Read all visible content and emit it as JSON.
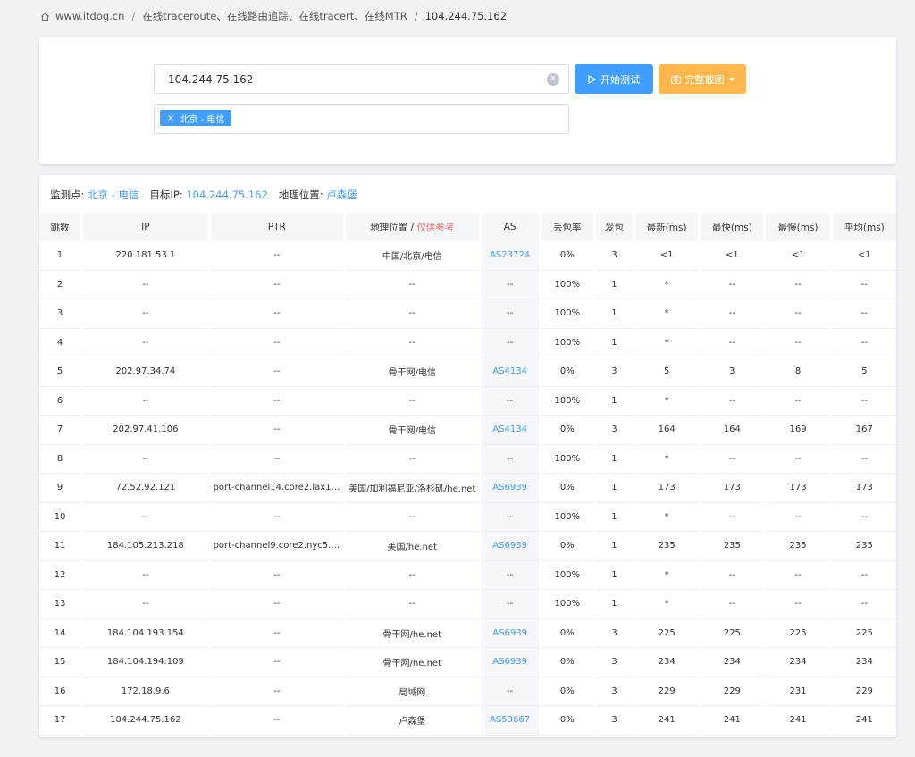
{
  "breadcrumb": {
    "home": "www.itdog.cn",
    "section": "在线traceroute、在线路由追踪、在线tracert、在线MTR",
    "current": "104.244.75.162"
  },
  "search": {
    "value": "104.244.75.162",
    "placeholder": ""
  },
  "buttons": {
    "start": "开始测试",
    "screenshot": "完整截图"
  },
  "tag": {
    "label": "北京 - 电信"
  },
  "meta": {
    "monitor_label": "监测点:",
    "monitor_value": "北京 - 电信",
    "target_label": "目标IP:",
    "target_value": "104.244.75.162",
    "geo_label": "地理位置:",
    "geo_value": "卢森堡"
  },
  "table": {
    "headers": {
      "hop": "跳数",
      "ip": "IP",
      "ptr": "PTR",
      "geo": "地理位置 /",
      "geo_note": "仅供参考",
      "as": "AS",
      "loss": "丢包率",
      "sent": "发包",
      "last": "最新(ms)",
      "best": "最快(ms)",
      "worst": "最慢(ms)",
      "avg": "平均(ms)"
    },
    "rows": [
      {
        "hop": "1",
        "ip": "220.181.53.1",
        "ptr": "--",
        "geo": "中国/北京/电信",
        "as": "AS23724",
        "loss": "0%",
        "sent": "3",
        "last": "<1",
        "best": "<1",
        "worst": "<1",
        "avg": "<1"
      },
      {
        "hop": "2",
        "ip": "--",
        "ptr": "--",
        "geo": "--",
        "as": "--",
        "loss": "100%",
        "sent": "1",
        "last": "*",
        "best": "--",
        "worst": "--",
        "avg": "--"
      },
      {
        "hop": "3",
        "ip": "--",
        "ptr": "--",
        "geo": "--",
        "as": "--",
        "loss": "100%",
        "sent": "1",
        "last": "*",
        "best": "--",
        "worst": "--",
        "avg": "--"
      },
      {
        "hop": "4",
        "ip": "--",
        "ptr": "--",
        "geo": "--",
        "as": "--",
        "loss": "100%",
        "sent": "1",
        "last": "*",
        "best": "--",
        "worst": "--",
        "avg": "--"
      },
      {
        "hop": "5",
        "ip": "202.97.34.74",
        "ptr": "--",
        "geo": "骨干网/电信",
        "as": "AS4134",
        "loss": "0%",
        "sent": "3",
        "last": "5",
        "best": "3",
        "worst": "8",
        "avg": "5"
      },
      {
        "hop": "6",
        "ip": "--",
        "ptr": "--",
        "geo": "--",
        "as": "--",
        "loss": "100%",
        "sent": "1",
        "last": "*",
        "best": "--",
        "worst": "--",
        "avg": "--"
      },
      {
        "hop": "7",
        "ip": "202.97.41.106",
        "ptr": "--",
        "geo": "骨干网/电信",
        "as": "AS4134",
        "loss": "0%",
        "sent": "3",
        "last": "164",
        "best": "164",
        "worst": "169",
        "avg": "167"
      },
      {
        "hop": "8",
        "ip": "--",
        "ptr": "--",
        "geo": "--",
        "as": "--",
        "loss": "100%",
        "sent": "1",
        "last": "*",
        "best": "--",
        "worst": "--",
        "avg": "--"
      },
      {
        "hop": "9",
        "ip": "72.52.92.121",
        "ptr": "port-channel14.core2.lax1.he...",
        "geo": "美国/加利福尼亚/洛杉矶/he.net",
        "as": "AS6939",
        "loss": "0%",
        "sent": "1",
        "last": "173",
        "best": "173",
        "worst": "173",
        "avg": "173"
      },
      {
        "hop": "10",
        "ip": "--",
        "ptr": "--",
        "geo": "--",
        "as": "--",
        "loss": "100%",
        "sent": "1",
        "last": "*",
        "best": "--",
        "worst": "--",
        "avg": "--"
      },
      {
        "hop": "11",
        "ip": "184.105.213.218",
        "ptr": "port-channel9.core2.nyc5.he....",
        "geo": "美国/he.net",
        "as": "AS6939",
        "loss": "0%",
        "sent": "1",
        "last": "235",
        "best": "235",
        "worst": "235",
        "avg": "235"
      },
      {
        "hop": "12",
        "ip": "--",
        "ptr": "--",
        "geo": "--",
        "as": "--",
        "loss": "100%",
        "sent": "1",
        "last": "*",
        "best": "--",
        "worst": "--",
        "avg": "--"
      },
      {
        "hop": "13",
        "ip": "--",
        "ptr": "--",
        "geo": "--",
        "as": "--",
        "loss": "100%",
        "sent": "1",
        "last": "*",
        "best": "--",
        "worst": "--",
        "avg": "--"
      },
      {
        "hop": "14",
        "ip": "184.104.193.154",
        "ptr": "--",
        "geo": "骨干网/he.net",
        "as": "AS6939",
        "loss": "0%",
        "sent": "3",
        "last": "225",
        "best": "225",
        "worst": "225",
        "avg": "225"
      },
      {
        "hop": "15",
        "ip": "184.104.194.109",
        "ptr": "--",
        "geo": "骨干网/he.net",
        "as": "AS6939",
        "loss": "0%",
        "sent": "3",
        "last": "234",
        "best": "234",
        "worst": "234",
        "avg": "234"
      },
      {
        "hop": "16",
        "ip": "172.18.9.6",
        "ptr": "--",
        "geo": "局域网",
        "as": "--",
        "loss": "0%",
        "sent": "3",
        "last": "229",
        "best": "229",
        "worst": "231",
        "avg": "229"
      },
      {
        "hop": "17",
        "ip": "104.244.75.162",
        "ptr": "--",
        "geo": "卢森堡",
        "as": "AS53667",
        "loss": "0%",
        "sent": "3",
        "last": "241",
        "best": "241",
        "worst": "241",
        "avg": "241"
      }
    ]
  },
  "colors": {
    "primary": "#409eff",
    "warning": "#ffb74d",
    "danger": "#f56c6c"
  }
}
